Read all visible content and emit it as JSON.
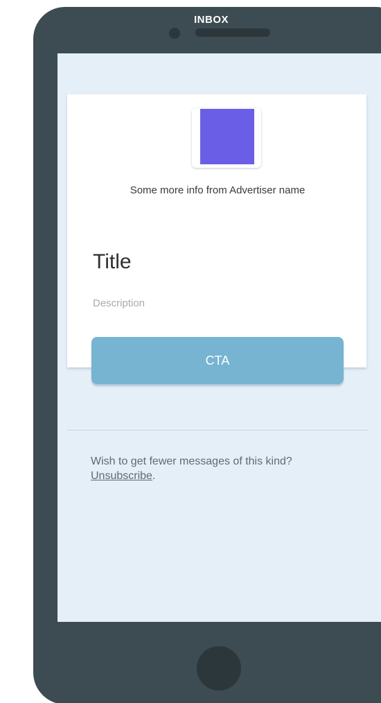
{
  "header": {
    "inbox_label": "INBOX"
  },
  "card": {
    "advertiser_info": "Some more info from Advertiser name",
    "title": "Title",
    "description": "Description",
    "cta_label": "CTA",
    "logo_color": "#6b5ee6"
  },
  "footer": {
    "message": "Wish to get fewer messages of this kind? ",
    "unsubscribe_label": "Unsubscribe",
    "end_punctuation": "."
  },
  "colors": {
    "phone_body": "#3d4b52",
    "screen_background": "#e4eff8",
    "cta_background": "#76b4d2"
  }
}
